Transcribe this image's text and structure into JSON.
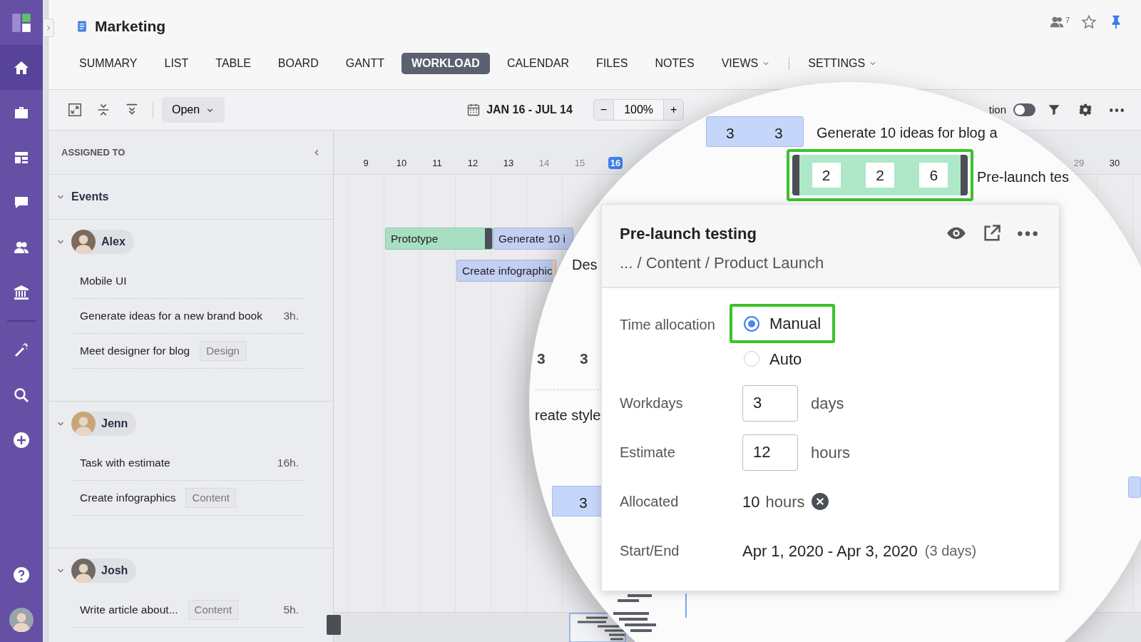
{
  "sidebar": {
    "items": [
      {
        "selected": true
      },
      {
        "selected": false
      },
      {
        "selected": false
      },
      {
        "selected": false
      },
      {
        "selected": false
      },
      {
        "selected": false
      },
      {
        "selected": false
      },
      {
        "selected": false
      },
      {
        "selected": false
      }
    ]
  },
  "header": {
    "title": "Marketing",
    "members_count": "7",
    "starred": false,
    "pinned": true
  },
  "tabs": [
    {
      "label": "SUMMARY",
      "selected": false,
      "dropdown": false
    },
    {
      "label": "LIST",
      "selected": false,
      "dropdown": false
    },
    {
      "label": "TABLE",
      "selected": false,
      "dropdown": false
    },
    {
      "label": "BOARD",
      "selected": false,
      "dropdown": false
    },
    {
      "label": "GANTT",
      "selected": false,
      "dropdown": false
    },
    {
      "label": "WORKLOAD",
      "selected": true,
      "dropdown": false
    },
    {
      "label": "CALENDAR",
      "selected": false,
      "dropdown": false
    },
    {
      "label": "FILES",
      "selected": false,
      "dropdown": false
    },
    {
      "label": "NOTES",
      "selected": false,
      "dropdown": false
    },
    {
      "label": "VIEWS",
      "selected": false,
      "dropdown": true
    },
    {
      "label": "SETTINGS",
      "selected": false,
      "dropdown": true
    }
  ],
  "toolbar": {
    "open_button": "Open",
    "date_range": "JAN 16 - JUL 14",
    "zoom_minus": "−",
    "zoom_value": "100%",
    "zoom_plus": "+",
    "allocation_label": "tion",
    "allocation_on": false
  },
  "panel": {
    "header": "ASSIGNED TO",
    "groups": [
      {
        "kind": "group",
        "name": "Events",
        "expanded": true
      },
      {
        "kind": "person",
        "name": "Alex",
        "expanded": true,
        "tasks": [
          {
            "title": "Mobile UI"
          },
          {
            "title": "Generate ideas for a new brand book",
            "estimate": "3h."
          },
          {
            "title": "Meet designer for blog",
            "tag": "Design"
          }
        ]
      },
      {
        "kind": "person",
        "name": "Jenn",
        "expanded": true,
        "tasks": [
          {
            "title": "Task with estimate",
            "estimate": "16h."
          },
          {
            "title": "Create infographics",
            "tag": "Content"
          }
        ]
      },
      {
        "kind": "person",
        "name": "Josh",
        "expanded": true,
        "tasks": [
          {
            "title": "Write article about...",
            "tag": "Content",
            "estimate": "5h."
          }
        ]
      }
    ]
  },
  "timeline": {
    "day_groups": [
      [
        {
          "label": "9",
          "weekend": false,
          "today": false
        },
        {
          "label": "10",
          "weekend": false,
          "today": false
        },
        {
          "label": "11",
          "weekend": false,
          "today": false
        },
        {
          "label": "12",
          "weekend": false,
          "today": false
        },
        {
          "label": "13",
          "weekend": false,
          "today": false
        },
        {
          "label": "14",
          "weekend": true,
          "today": false
        },
        {
          "label": "15",
          "weekend": true,
          "today": false
        },
        {
          "label": "16",
          "weekend": false,
          "today": true
        }
      ],
      [
        {
          "label": "29",
          "weekend": true,
          "today": false
        },
        {
          "label": "30",
          "weekend": false,
          "today": false
        }
      ]
    ],
    "bars": [
      {
        "label": "Prototype",
        "color": "#a8dfc2",
        "end_handle": true
      },
      {
        "label": "Generate 10 i",
        "color": "#c3d0f3",
        "end_handle": false
      },
      {
        "label": "Create infographic",
        "color": "#c3d0f3",
        "end_handle": false,
        "end_marker": true
      }
    ]
  },
  "magnifier": {
    "top_bar": {
      "values": [
        "3",
        "3"
      ],
      "title": "Generate 10 ideas for blog a"
    },
    "selected_bar": {
      "values": [
        "2",
        "2",
        "6"
      ],
      "title": "Pre-launch tes",
      "highlighted": true
    },
    "texts": [
      "Des",
      "reate style"
    ],
    "row_values": [
      "3",
      "3"
    ],
    "lower_bar": {
      "values": [
        "3"
      ]
    }
  },
  "card": {
    "title": "Pre-launch testing",
    "breadcrumb": "... / Content / Product Launch",
    "fields": [
      {
        "kind": "radio",
        "label": "Time allocation",
        "options": [
          {
            "label": "Manual",
            "selected": true,
            "highlighted": true
          },
          {
            "label": "Auto",
            "selected": false,
            "highlighted": false
          }
        ]
      },
      {
        "kind": "input",
        "label": "Workdays",
        "value": "3",
        "unit": "days"
      },
      {
        "kind": "input",
        "label": "Estimate",
        "value": "12",
        "unit": "hours"
      },
      {
        "kind": "value",
        "label": "Allocated",
        "value": "10",
        "unit": "hours",
        "clearable": true
      },
      {
        "kind": "value",
        "label": "Start/End",
        "value": "Apr 1, 2020 - Apr 3, 2020",
        "note": "(3 days)"
      }
    ]
  }
}
